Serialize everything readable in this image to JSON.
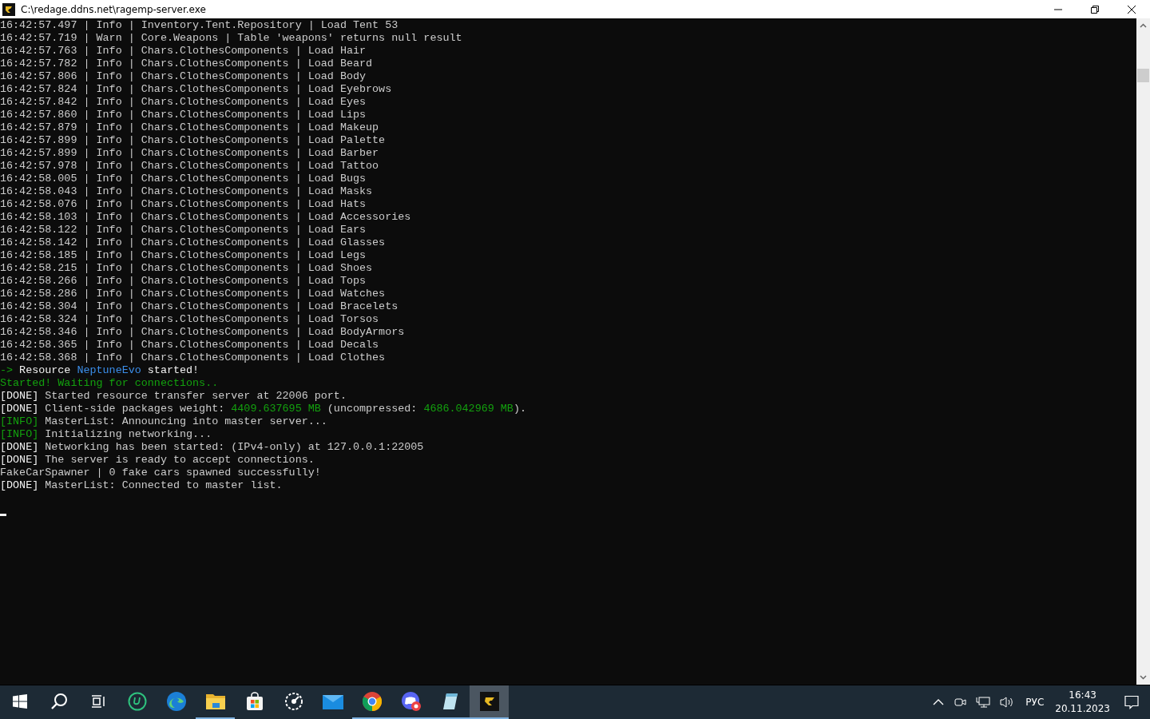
{
  "window": {
    "title": "C:\\redage.ddns.net\\ragemp-server.exe"
  },
  "console": {
    "lines": [
      [
        {
          "text": "16:42:57.497 | Info | Inventory.Tent.Repository | Load Tent 53",
          "color": "#cccccc"
        }
      ],
      [
        {
          "text": "16:42:57.719 | Warn | Core.Weapons | Table 'weapons' returns null result",
          "color": "#cccccc"
        }
      ],
      [
        {
          "text": "16:42:57.763 | Info | Chars.ClothesComponents | Load Hair",
          "color": "#cccccc"
        }
      ],
      [
        {
          "text": "16:42:57.782 | Info | Chars.ClothesComponents | Load Beard",
          "color": "#cccccc"
        }
      ],
      [
        {
          "text": "16:42:57.806 | Info | Chars.ClothesComponents | Load Body",
          "color": "#cccccc"
        }
      ],
      [
        {
          "text": "16:42:57.824 | Info | Chars.ClothesComponents | Load Eyebrows",
          "color": "#cccccc"
        }
      ],
      [
        {
          "text": "16:42:57.842 | Info | Chars.ClothesComponents | Load Eyes",
          "color": "#cccccc"
        }
      ],
      [
        {
          "text": "16:42:57.860 | Info | Chars.ClothesComponents | Load Lips",
          "color": "#cccccc"
        }
      ],
      [
        {
          "text": "16:42:57.879 | Info | Chars.ClothesComponents | Load Makeup",
          "color": "#cccccc"
        }
      ],
      [
        {
          "text": "16:42:57.899 | Info | Chars.ClothesComponents | Load Palette",
          "color": "#cccccc"
        }
      ],
      [
        {
          "text": "16:42:57.899 | Info | Chars.ClothesComponents | Load Barber",
          "color": "#cccccc"
        }
      ],
      [
        {
          "text": "16:42:57.978 | Info | Chars.ClothesComponents | Load Tattoo",
          "color": "#cccccc"
        }
      ],
      [
        {
          "text": "16:42:58.005 | Info | Chars.ClothesComponents | Load Bugs",
          "color": "#cccccc"
        }
      ],
      [
        {
          "text": "16:42:58.043 | Info | Chars.ClothesComponents | Load Masks",
          "color": "#cccccc"
        }
      ],
      [
        {
          "text": "16:42:58.076 | Info | Chars.ClothesComponents | Load Hats",
          "color": "#cccccc"
        }
      ],
      [
        {
          "text": "16:42:58.103 | Info | Chars.ClothesComponents | Load Accessories",
          "color": "#cccccc"
        }
      ],
      [
        {
          "text": "16:42:58.122 | Info | Chars.ClothesComponents | Load Ears",
          "color": "#cccccc"
        }
      ],
      [
        {
          "text": "16:42:58.142 | Info | Chars.ClothesComponents | Load Glasses",
          "color": "#cccccc"
        }
      ],
      [
        {
          "text": "16:42:58.185 | Info | Chars.ClothesComponents | Load Legs",
          "color": "#cccccc"
        }
      ],
      [
        {
          "text": "16:42:58.215 | Info | Chars.ClothesComponents | Load Shoes",
          "color": "#cccccc"
        }
      ],
      [
        {
          "text": "16:42:58.266 | Info | Chars.ClothesComponents | Load Tops",
          "color": "#cccccc"
        }
      ],
      [
        {
          "text": "16:42:58.286 | Info | Chars.ClothesComponents | Load Watches",
          "color": "#cccccc"
        }
      ],
      [
        {
          "text": "16:42:58.304 | Info | Chars.ClothesComponents | Load Bracelets",
          "color": "#cccccc"
        }
      ],
      [
        {
          "text": "16:42:58.324 | Info | Chars.ClothesComponents | Load Torsos",
          "color": "#cccccc"
        }
      ],
      [
        {
          "text": "16:42:58.346 | Info | Chars.ClothesComponents | Load BodyArmors",
          "color": "#cccccc"
        }
      ],
      [
        {
          "text": "16:42:58.365 | Info | Chars.ClothesComponents | Load Decals",
          "color": "#cccccc"
        }
      ],
      [
        {
          "text": "16:42:58.368 | Info | Chars.ClothesComponents | Load Clothes",
          "color": "#cccccc"
        }
      ],
      [
        {
          "text": "-> ",
          "color": "#13a10e"
        },
        {
          "text": "Resource ",
          "color": "#f2f2f2"
        },
        {
          "text": "NeptuneEvo",
          "color": "#3b8eea"
        },
        {
          "text": " started!",
          "color": "#f2f2f2"
        }
      ],
      [
        {
          "text": "Started! Waiting for connections..",
          "color": "#13a10e"
        }
      ],
      [
        {
          "text": "[DONE]",
          "color": "#f2f2f2"
        },
        {
          "text": " Started resource transfer server at 22006 port.",
          "color": "#cccccc"
        }
      ],
      [
        {
          "text": "[DONE]",
          "color": "#f2f2f2"
        },
        {
          "text": " Client-side packages weight: ",
          "color": "#cccccc"
        },
        {
          "text": "4409.637695 MB",
          "color": "#13a10e"
        },
        {
          "text": " (uncompressed: ",
          "color": "#cccccc"
        },
        {
          "text": "4686.042969 MB",
          "color": "#13a10e"
        },
        {
          "text": ").",
          "color": "#cccccc"
        }
      ],
      [
        {
          "text": "[INFO]",
          "color": "#13a10e"
        },
        {
          "text": " MasterList: Announcing into master server...",
          "color": "#cccccc"
        }
      ],
      [
        {
          "text": "[INFO]",
          "color": "#13a10e"
        },
        {
          "text": " Initializing networking...",
          "color": "#cccccc"
        }
      ],
      [
        {
          "text": "[DONE]",
          "color": "#f2f2f2"
        },
        {
          "text": " Networking has been started: (IPv4-only) at 127.0.0.1:22005",
          "color": "#cccccc"
        }
      ],
      [
        {
          "text": "[DONE]",
          "color": "#f2f2f2"
        },
        {
          "text": " The server is ready to accept connections.",
          "color": "#cccccc"
        }
      ],
      [
        {
          "text": "FakeCarSpawner | 0 fake cars spawned successfully!",
          "color": "#cccccc"
        }
      ],
      [
        {
          "text": "[DONE]",
          "color": "#f2f2f2"
        },
        {
          "text": " MasterList: Connected to master list.",
          "color": "#cccccc"
        }
      ]
    ]
  },
  "taskbar": {
    "items": [
      {
        "kind": "start",
        "running": false,
        "selected": false
      },
      {
        "kind": "search",
        "running": false,
        "selected": false
      },
      {
        "kind": "taskview",
        "running": false,
        "selected": false
      },
      {
        "kind": "uapp",
        "running": false,
        "selected": false
      },
      {
        "kind": "edge",
        "running": false,
        "selected": false
      },
      {
        "kind": "folder",
        "running": true,
        "selected": false
      },
      {
        "kind": "store",
        "running": false,
        "selected": false
      },
      {
        "kind": "gauge",
        "running": false,
        "selected": false
      },
      {
        "kind": "mail",
        "running": false,
        "selected": false
      },
      {
        "kind": "chrome",
        "running": true,
        "selected": false
      },
      {
        "kind": "discord",
        "running": true,
        "selected": false
      },
      {
        "kind": "notepad",
        "running": true,
        "selected": false
      },
      {
        "kind": "ragemp",
        "running": true,
        "selected": true
      }
    ],
    "language": "РУС",
    "time": "16:43",
    "date": "20.11.2023"
  }
}
